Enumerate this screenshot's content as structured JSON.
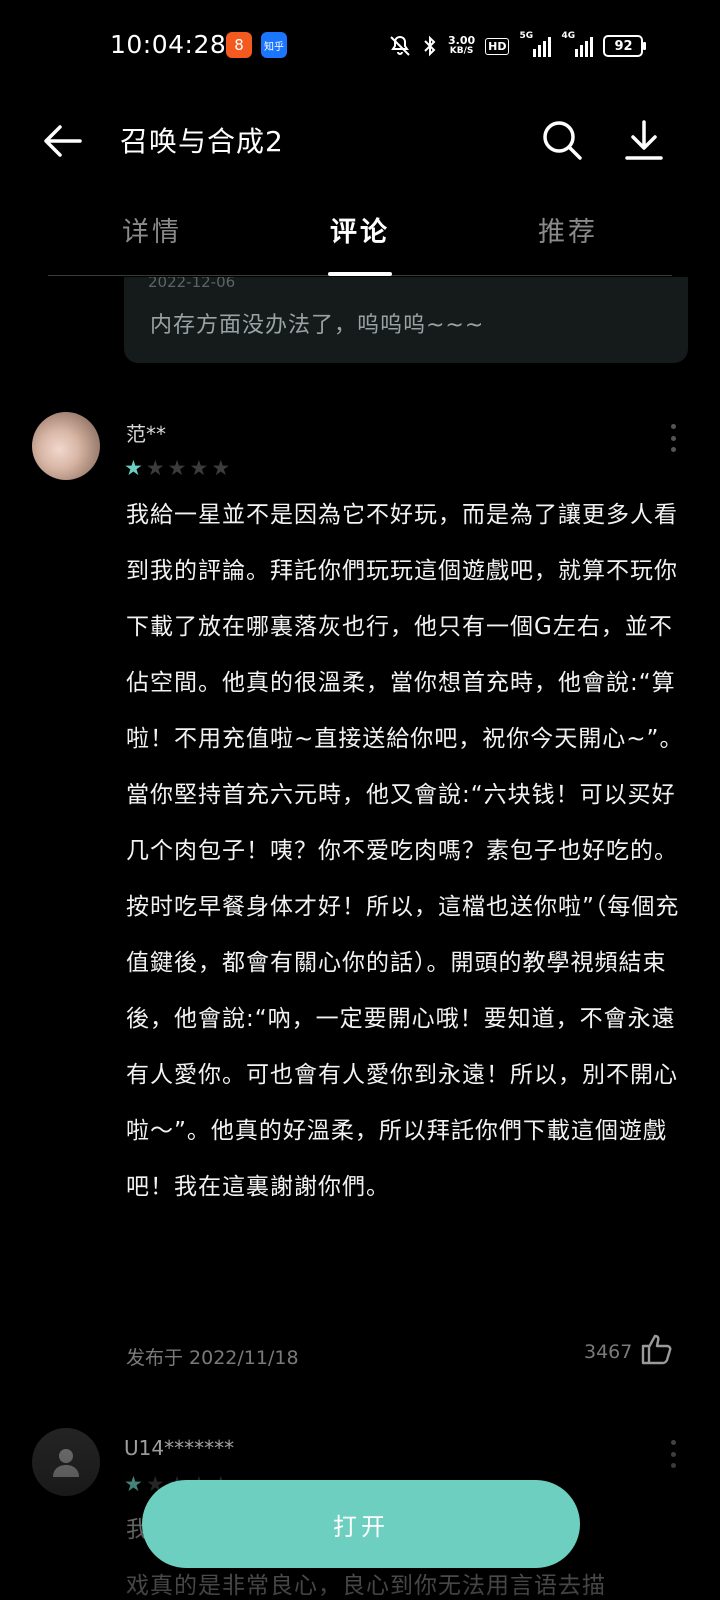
{
  "status_bar": {
    "time": "10:04:28",
    "app_badge_1": "8",
    "app_badge_2": "知乎",
    "net_speed_value": "3.00",
    "net_speed_unit": "KB/S",
    "hd_label": "HD",
    "signal_1": "5G",
    "signal_2": "4G",
    "battery": "92"
  },
  "header": {
    "title": "召唤与合成2"
  },
  "tabs": [
    {
      "label": "详情",
      "active": false
    },
    {
      "label": "评论",
      "active": true
    },
    {
      "label": "推荐",
      "active": false
    }
  ],
  "reply_card": {
    "date": "2022-12-06",
    "text": "内存方面没办法了，呜呜呜~~~"
  },
  "comment": {
    "user": "范**",
    "rating": 1,
    "max_rating": 5,
    "body": "我給一星並不是因為它不好玩，而是為了讓更多人看到我的評論。拜託你們玩玩這個遊戲吧，就算不玩你下載了放在哪裏落灰也行，他只有一個G左右，並不佔空間。他真的很溫柔，當你想首充時，他會說:“算啦！不用充值啦~直接送給你吧，祝你今天開心~”。當你堅持首充六元時，他又會說:“六块钱！可以买好几个肉包子！咦？你不爱吃肉嗎？素包子也好吃的。按时吃早餐身体才好！所以，這檔也送你啦”（每個充值鍵後，都會有關心你的話）。開頭的教學視頻結束後，他會說:“吶，一定要開心哦！要知道，不會永遠有人愛你。可也會有人愛你到永遠！所以，別不開心啦～”。他真的好溫柔，所以拜託你們下載這個遊戲吧！我在這裏謝謝你們。",
    "date": "发布于 2022/11/18",
    "likes": "3467"
  },
  "comment2": {
    "user": "U14*******",
    "rating": 1,
    "body_line1": "我                                                 ，这游",
    "body_line2": "戏真的是非常良心，良心到你无法用言语去描"
  },
  "open_button": {
    "label": "打开"
  },
  "colors": {
    "accent": "#6dcfbf",
    "background": "#000000"
  }
}
